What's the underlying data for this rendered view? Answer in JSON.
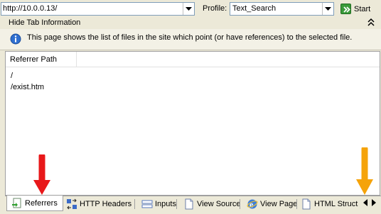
{
  "toolbar": {
    "url_value": "http://10.0.0.13/",
    "profile_label": "Profile:",
    "profile_value": "Text_Search",
    "start_label": "Start"
  },
  "panel": {
    "hide_tab_label": "Hide Tab Information",
    "info_text": "This page shows the list of files in the site which point (or have references) to the selected file."
  },
  "list": {
    "column_header": "Referrer Path",
    "rows": [
      "/",
      "/exist.htm"
    ]
  },
  "tabs": [
    {
      "label": "Referrers",
      "icon": "referrers-icon",
      "active": true
    },
    {
      "label": "HTTP Headers",
      "icon": "http-headers-icon",
      "active": false
    },
    {
      "label": "Inputs",
      "icon": "inputs-icon",
      "active": false
    },
    {
      "label": "View Source",
      "icon": "view-source-icon",
      "active": false
    },
    {
      "label": "View Page",
      "icon": "ie-icon",
      "active": false
    },
    {
      "label": "HTML Struct",
      "icon": "html-struct-icon",
      "active": false
    }
  ],
  "colors": {
    "annotation_red": "#e8181a",
    "annotation_orange": "#f5a30a",
    "start_green": "#3a9a3a"
  }
}
